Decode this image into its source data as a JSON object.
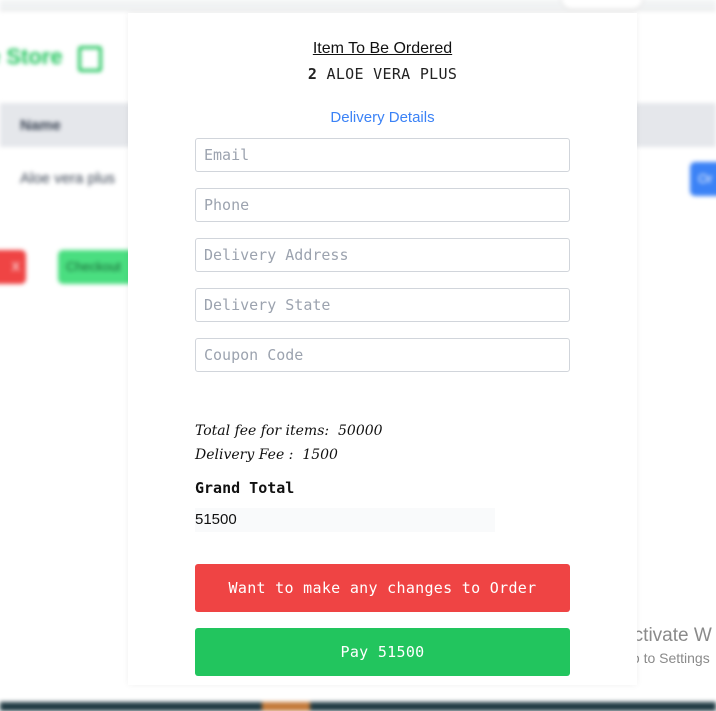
{
  "background_page": {
    "store_title": "e Store",
    "table_header_name": "Name",
    "row_item_name": "Aloe vera plus",
    "btn_remove": "X",
    "btn_checkout": "Checkout",
    "btn_order": "Or"
  },
  "modal": {
    "heading": "Item To Be Ordered",
    "item_quantity": "2",
    "item_name": "ALOE VERA PLUS",
    "delivery_heading": "Delivery Details",
    "fields": {
      "email_placeholder": "Email",
      "phone_placeholder": "Phone",
      "address_placeholder": "Delivery Address",
      "state_placeholder": "Delivery State",
      "coupon_placeholder": "Coupon Code"
    },
    "fees": {
      "items_label": "Total fee for items:",
      "items_value": "50000",
      "delivery_label": "Delivery Fee :",
      "delivery_value": "1500"
    },
    "grand_total_label": "Grand Total",
    "grand_total_value": "51500",
    "change_order_button": "Want to make any changes to Order",
    "pay_button": "Pay 51500"
  },
  "watermark": {
    "line1": "Activate W",
    "line2": "Go to Settings"
  },
  "colors": {
    "accent_blue": "#3b82f6",
    "danger_red": "#ef4444",
    "success_green": "#22c55e"
  }
}
